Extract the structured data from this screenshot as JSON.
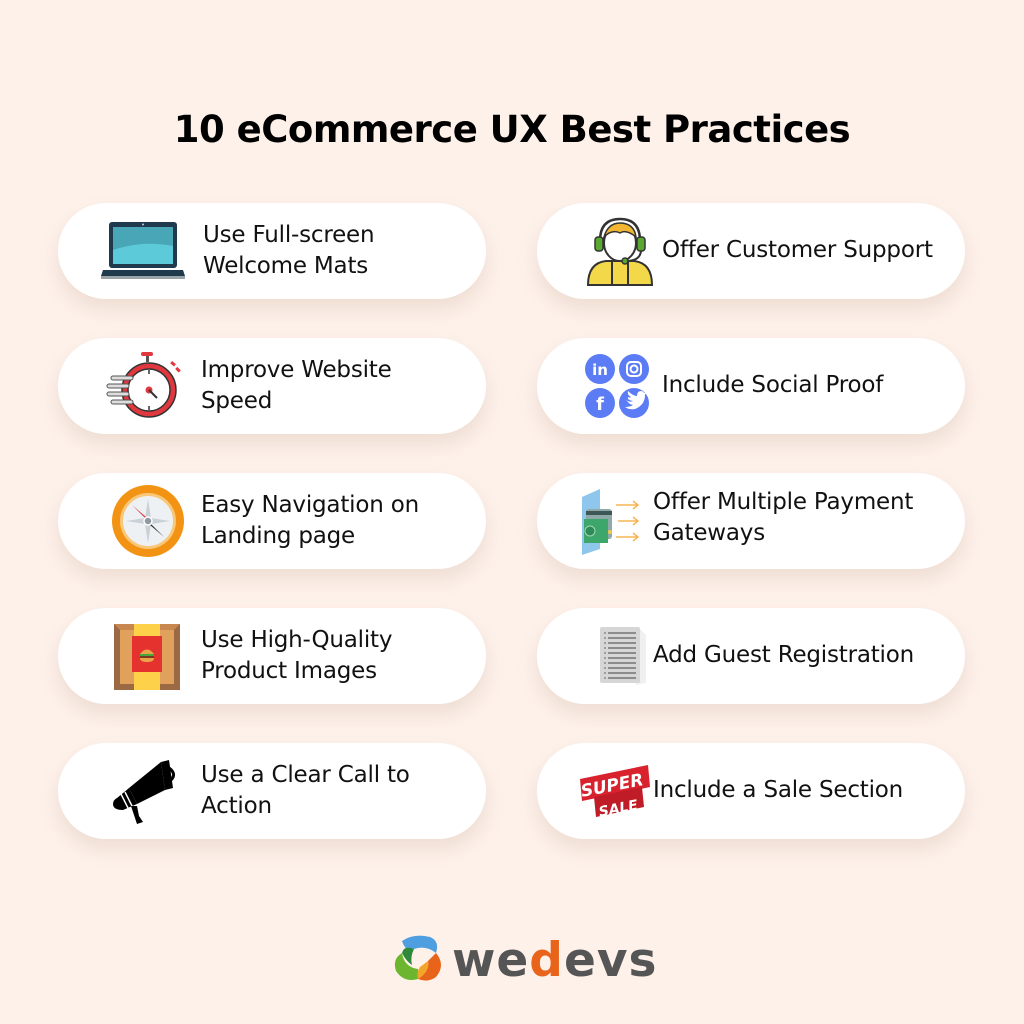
{
  "title": "10 eCommerce UX Best Practices",
  "practices": [
    {
      "label": "Use Full-screen Welcome Mats",
      "icon": "laptop-icon"
    },
    {
      "label": "Offer Customer Support",
      "icon": "customer-support-headset-icon"
    },
    {
      "label": "Improve Website Speed",
      "icon": "stopwatch-icon"
    },
    {
      "label": "Include Social Proof",
      "icon": "social-media-icons"
    },
    {
      "label": "Easy Navigation on Landing page",
      "icon": "compass-icon"
    },
    {
      "label": "Offer Multiple Payment Gateways",
      "icon": "payment-card-icon"
    },
    {
      "label": "Use High-Quality Product Images",
      "icon": "product-box-icon"
    },
    {
      "label": "Add Guest Registration",
      "icon": "form-document-icon"
    },
    {
      "label": "Use a Clear Call to Action",
      "icon": "megaphone-icon"
    },
    {
      "label": "Include a Sale Section",
      "icon": "super-sale-icon"
    }
  ],
  "sale_badge": {
    "line1": "SUPER",
    "line2": "SALE"
  },
  "social_glyphs": {
    "linkedin": "in",
    "facebook": "f"
  },
  "logo": {
    "part1": "we",
    "part2": "d",
    "part3": "evs"
  },
  "colors": {
    "background": "#fdf1ea",
    "card": "#ffffff",
    "logo_accent": "#e8641b",
    "social_blue": "#5b7cf5"
  }
}
